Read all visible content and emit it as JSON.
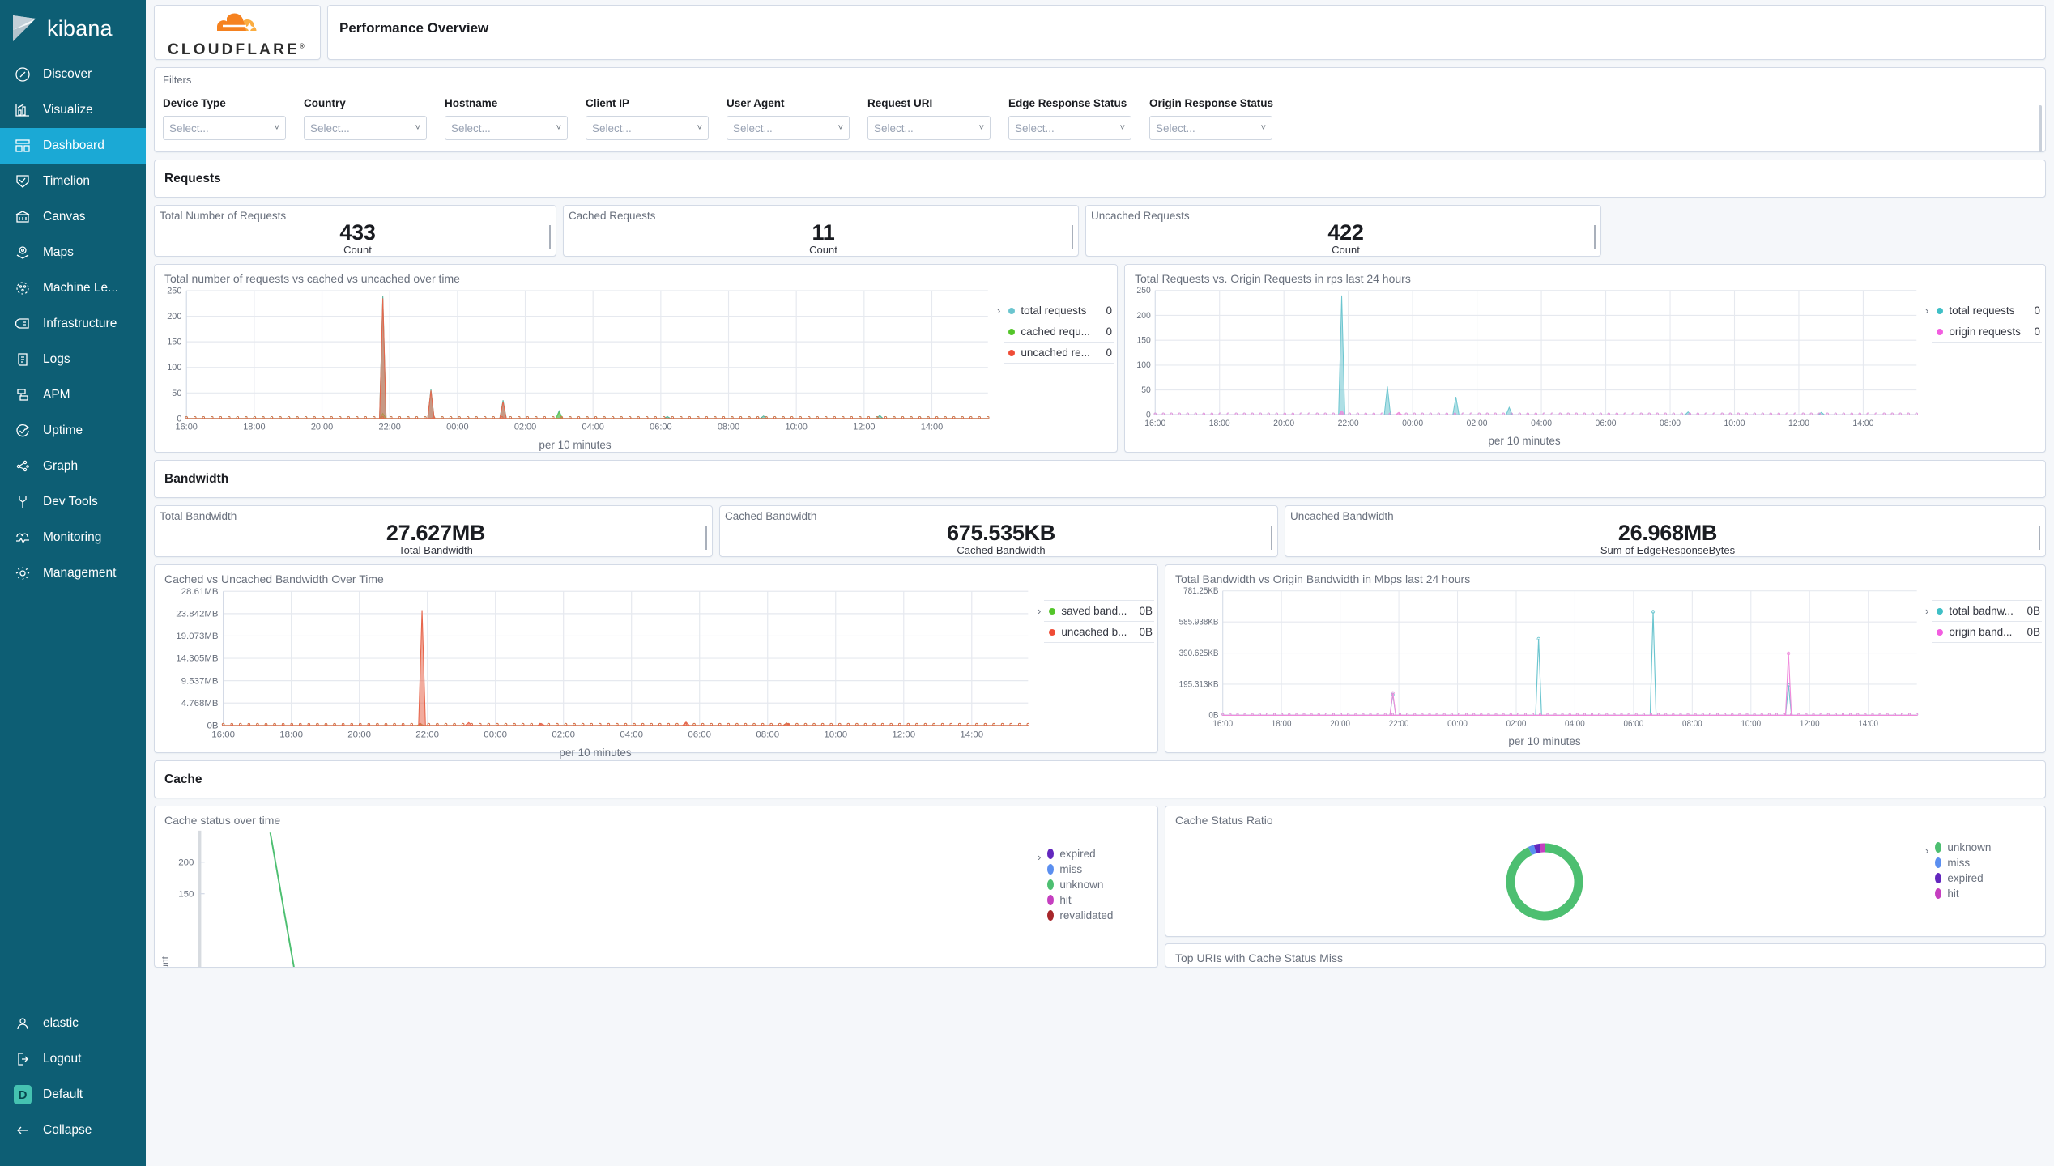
{
  "sidebar": {
    "brand": "kibana",
    "items": [
      {
        "label": "Discover",
        "icon": "compass-icon"
      },
      {
        "label": "Visualize",
        "icon": "bar-chart-icon"
      },
      {
        "label": "Dashboard",
        "icon": "dashboard-icon",
        "active": true
      },
      {
        "label": "Timelion",
        "icon": "timelion-icon"
      },
      {
        "label": "Canvas",
        "icon": "canvas-icon"
      },
      {
        "label": "Maps",
        "icon": "map-pin-icon"
      },
      {
        "label": "Machine Le...",
        "icon": "machine-learning-icon"
      },
      {
        "label": "Infrastructure",
        "icon": "infrastructure-icon"
      },
      {
        "label": "Logs",
        "icon": "logs-icon"
      },
      {
        "label": "APM",
        "icon": "apm-icon"
      },
      {
        "label": "Uptime",
        "icon": "uptime-icon"
      },
      {
        "label": "Graph",
        "icon": "graph-icon"
      },
      {
        "label": "Dev Tools",
        "icon": "wrench-icon"
      },
      {
        "label": "Monitoring",
        "icon": "monitoring-icon"
      },
      {
        "label": "Management",
        "icon": "gear-icon"
      }
    ],
    "bottom": [
      {
        "label": "elastic",
        "icon": "user-icon"
      },
      {
        "label": "Logout",
        "icon": "logout-icon"
      },
      {
        "label": "Default",
        "icon": "space-avatar",
        "badge": "D"
      },
      {
        "label": "Collapse",
        "icon": "arrow-left-icon"
      }
    ],
    "colors": {
      "bg": "#0d5e74",
      "active": "#1ba9d5",
      "avatar": "#45c2b1"
    }
  },
  "header": {
    "logo_text": "CLOUDFLARE",
    "logo_reg": "®",
    "title": "Performance Overview"
  },
  "filters": {
    "label": "Filters",
    "placeholder": "Select...",
    "fields": [
      {
        "label": "Device Type"
      },
      {
        "label": "Country"
      },
      {
        "label": "Hostname"
      },
      {
        "label": "Client IP"
      },
      {
        "label": "User Agent"
      },
      {
        "label": "Request URI"
      },
      {
        "label": "Edge Response Status"
      },
      {
        "label": "Origin Response Status"
      }
    ]
  },
  "sections": {
    "requests": "Requests",
    "bandwidth": "Bandwidth",
    "cache": "Cache"
  },
  "request_metrics": [
    {
      "title": "Total Number of Requests",
      "value": "433",
      "sub": "Count"
    },
    {
      "title": "Cached Requests",
      "value": "11",
      "sub": "Count"
    },
    {
      "title": "Uncached Requests",
      "value": "422",
      "sub": "Count"
    }
  ],
  "bandwidth_metrics": [
    {
      "title": "Total Bandwidth",
      "value": "27.627MB",
      "sub": "Total Bandwidth"
    },
    {
      "title": "Cached Bandwidth",
      "value": "675.535KB",
      "sub": "Cached Bandwidth"
    },
    {
      "title": "Uncached Bandwidth",
      "value": "26.968MB",
      "sub": "Sum of EdgeResponseBytes"
    }
  ],
  "chart_data": [
    {
      "id": "requests_over_time",
      "type": "area",
      "title": "Total number of requests vs cached vs uncached over time",
      "xlabel": "per 10 minutes",
      "ylabel": "",
      "ylim": [
        0,
        250
      ],
      "yticks": [
        0,
        50,
        100,
        150,
        200,
        250
      ],
      "xticks": [
        "16:00",
        "18:00",
        "20:00",
        "22:00",
        "00:00",
        "02:00",
        "04:00",
        "06:00",
        "08:00",
        "10:00",
        "12:00",
        "14:00"
      ],
      "grid": true,
      "legend_position": "right",
      "series": [
        {
          "name": "total requests",
          "value": "0",
          "color": "#54b399",
          "peaks": [
            {
              "x": 0.245,
              "y": 240
            },
            {
              "x": 0.305,
              "y": 57
            },
            {
              "x": 0.395,
              "y": 36
            },
            {
              "x": 0.465,
              "y": 15
            },
            {
              "x": 0.6,
              "y": 4
            },
            {
              "x": 0.72,
              "y": 5
            },
            {
              "x": 0.865,
              "y": 6
            }
          ]
        },
        {
          "name": "cached requ...",
          "value": "0",
          "color": "#6dcc4e",
          "peaks": [
            {
              "x": 0.245,
              "y": 10
            },
            {
              "x": 0.465,
              "y": 12
            }
          ]
        },
        {
          "name": "uncached re...",
          "value": "0",
          "color": "#e7664c",
          "peaks": [
            {
              "x": 0.245,
              "y": 235
            },
            {
              "x": 0.305,
              "y": 55
            },
            {
              "x": 0.395,
              "y": 33
            }
          ]
        }
      ]
    },
    {
      "id": "requests_vs_origin",
      "type": "area",
      "title": "Total Requests vs. Origin Requests in rps last 24 hours",
      "xlabel": "per 10 minutes",
      "ylabel": "",
      "ylim": [
        0,
        250
      ],
      "yticks": [
        0,
        50,
        100,
        150,
        200,
        250
      ],
      "xticks": [
        "16:00",
        "18:00",
        "20:00",
        "22:00",
        "00:00",
        "02:00",
        "04:00",
        "06:00",
        "08:00",
        "10:00",
        "12:00",
        "14:00"
      ],
      "grid": true,
      "legend_position": "right",
      "series": [
        {
          "name": "total requests",
          "value": "0",
          "color": "#6bc5cf",
          "peaks": [
            {
              "x": 0.245,
              "y": 240
            },
            {
              "x": 0.305,
              "y": 57
            },
            {
              "x": 0.395,
              "y": 36
            },
            {
              "x": 0.465,
              "y": 15
            },
            {
              "x": 0.7,
              "y": 6
            },
            {
              "x": 0.875,
              "y": 5
            }
          ]
        },
        {
          "name": "origin requests",
          "value": "0",
          "color": "#f08bdc",
          "peaks": [
            {
              "x": 0.245,
              "y": 8
            },
            {
              "x": 0.32,
              "y": 5
            }
          ]
        }
      ]
    },
    {
      "id": "cached_vs_uncached_bandwidth",
      "type": "area",
      "title": "Cached vs Uncached Bandwidth Over Time",
      "xlabel": "per 10 minutes",
      "ylabel": "",
      "ylim": [
        0,
        28.61
      ],
      "yticks_labels": [
        "0B",
        "4.768MB",
        "9.537MB",
        "14.305MB",
        "19.073MB",
        "23.842MB",
        "28.61MB"
      ],
      "yticks": [
        0,
        4.768,
        9.537,
        14.305,
        19.073,
        23.842,
        28.61
      ],
      "xticks": [
        "16:00",
        "18:00",
        "20:00",
        "22:00",
        "00:00",
        "02:00",
        "04:00",
        "06:00",
        "08:00",
        "10:00",
        "12:00",
        "14:00"
      ],
      "grid": true,
      "legend_position": "right",
      "series": [
        {
          "name": "saved band...",
          "value": "0B",
          "color": "#6dcc4e",
          "peaks": [
            {
              "x": 0.245,
              "y": 0.3
            },
            {
              "x": 0.7,
              "y": 0.5
            }
          ]
        },
        {
          "name": "uncached b...",
          "value": "0B",
          "color": "#e7664c",
          "peaks": [
            {
              "x": 0.247,
              "y": 24.6
            },
            {
              "x": 0.305,
              "y": 0.6
            },
            {
              "x": 0.395,
              "y": 0.4
            },
            {
              "x": 0.575,
              "y": 0.7
            },
            {
              "x": 0.7,
              "y": 0.5
            }
          ]
        }
      ]
    },
    {
      "id": "bandwidth_vs_origin",
      "type": "line",
      "title": "Total Bandwidth vs Origin Bandwidth in Mbps last 24 hours",
      "xlabel": "per 10 minutes",
      "ylabel": "",
      "ylim": [
        0,
        781.25
      ],
      "yticks_labels": [
        "0B",
        "195.313KB",
        "390.625KB",
        "585.938KB",
        "781.25KB"
      ],
      "yticks": [
        0,
        195.313,
        390.625,
        585.938,
        781.25
      ],
      "xticks": [
        "16:00",
        "18:00",
        "20:00",
        "22:00",
        "00:00",
        "02:00",
        "04:00",
        "06:00",
        "08:00",
        "10:00",
        "12:00",
        "14:00"
      ],
      "grid": true,
      "legend_position": "right",
      "series": [
        {
          "name": "total badnw...",
          "value": "0B",
          "color": "#6bc5cf",
          "peaks": [
            {
              "x": 0.245,
              "y": 130
            },
            {
              "x": 0.455,
              "y": 480
            },
            {
              "x": 0.62,
              "y": 650
            },
            {
              "x": 0.815,
              "y": 190
            }
          ]
        },
        {
          "name": "origin band...",
          "value": "0B",
          "color": "#f08bdc",
          "peaks": [
            {
              "x": 0.245,
              "y": 140
            },
            {
              "x": 0.815,
              "y": 388
            }
          ]
        }
      ]
    },
    {
      "id": "cache_status_over_time",
      "type": "line",
      "title": "Cache status over time",
      "xlabel": "",
      "ylabel": "Count",
      "ylim": [
        0,
        250
      ],
      "yticks": [
        150,
        200
      ],
      "grid": false,
      "legend_position": "right",
      "series": [
        {
          "name": "expired",
          "color": "#6327be"
        },
        {
          "name": "miss",
          "color": "#5b8ff0"
        },
        {
          "name": "unknown",
          "color": "#4dbf71"
        },
        {
          "name": "hit",
          "color": "#c53fc0"
        },
        {
          "name": "revalidated",
          "color": "#a7272b"
        }
      ]
    },
    {
      "id": "cache_status_ratio",
      "type": "pie",
      "title": "Cache Status Ratio",
      "legend_position": "right",
      "labels": [
        "unknown",
        "miss",
        "expired",
        "hit"
      ],
      "values": [
        93,
        2.5,
        2.5,
        2
      ],
      "colors": [
        "#4dbf71",
        "#5b8ff0",
        "#6327be",
        "#c53fc0"
      ]
    }
  ],
  "bottom_panel": {
    "title": "Top URIs with Cache Status Miss"
  },
  "legend_toggle_glyph": "›"
}
